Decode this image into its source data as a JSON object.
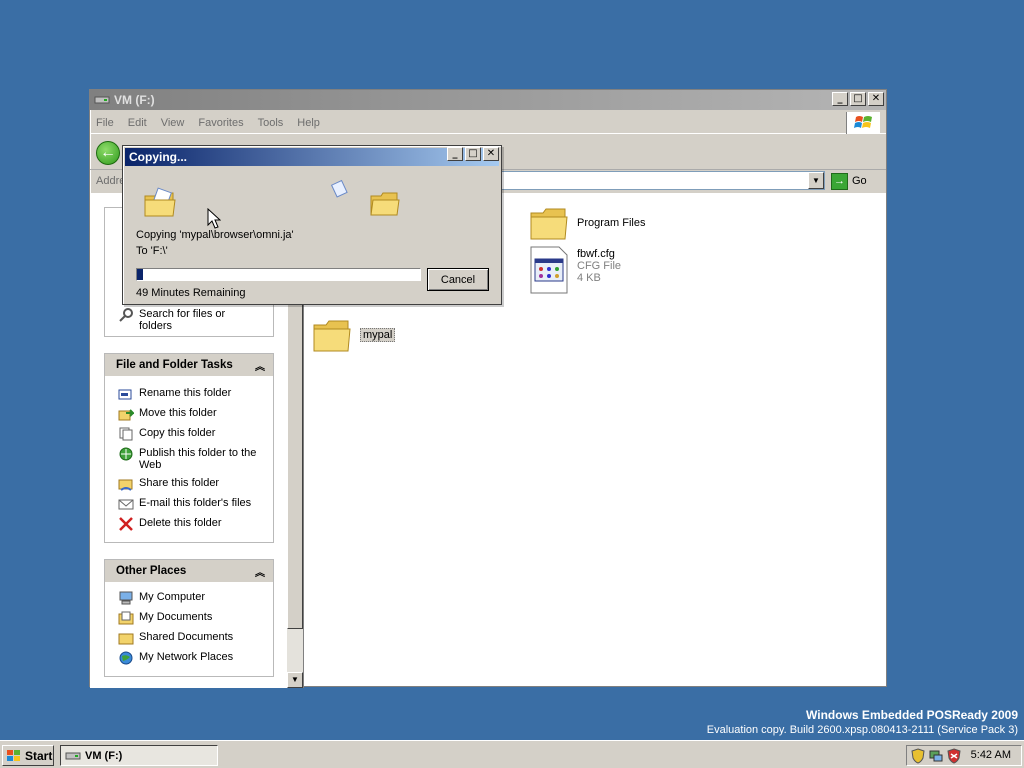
{
  "explorer": {
    "title": "VM (F:)",
    "menu": [
      "File",
      "Edit",
      "View",
      "Favorites",
      "Tools",
      "Help"
    ],
    "address_label": "Addre",
    "go_label": "Go"
  },
  "taskpane": {
    "file_tasks": {
      "title": "File and Folder Tasks",
      "items": [
        {
          "label": "Rename this folder",
          "icon": "rename-icon"
        },
        {
          "label": "Move this folder",
          "icon": "move-icon"
        },
        {
          "label": "Copy this folder",
          "icon": "copy-icon"
        },
        {
          "label": "Publish this folder to the Web",
          "icon": "publish-icon"
        },
        {
          "label": "Share this folder",
          "icon": "share-icon"
        },
        {
          "label": "E-mail this folder's files",
          "icon": "email-icon"
        },
        {
          "label": "Delete this folder",
          "icon": "delete-icon"
        }
      ]
    },
    "partial_search": {
      "label": "Search for files or folders"
    },
    "other_places": {
      "title": "Other Places",
      "items": [
        {
          "label": "My Computer",
          "icon": "my-computer-icon"
        },
        {
          "label": "My Documents",
          "icon": "my-documents-icon"
        },
        {
          "label": "Shared Documents",
          "icon": "shared-documents-icon"
        },
        {
          "label": "My Network Places",
          "icon": "network-places-icon"
        }
      ]
    }
  },
  "content": {
    "items": [
      {
        "name": "Program Files",
        "type": "folder"
      },
      {
        "name": "fbwf.cfg",
        "subtitle": "CFG File",
        "size": "4 KB",
        "type": "file"
      },
      {
        "name": "mypal",
        "type": "folder"
      }
    ]
  },
  "dialog": {
    "title": "Copying...",
    "copying_line": "Copying 'mypal\\browser\\omni.ja'",
    "to_line": "To 'F:\\'",
    "remaining": "49 Minutes Remaining",
    "cancel_label": "Cancel",
    "progress_fraction": 0.02
  },
  "watermark": {
    "line1": "Windows Embedded POSReady 2009",
    "line2": "Evaluation copy. Build 2600.xpsp.080413-2111 (Service Pack 3)"
  },
  "taskbar": {
    "start_label": "Start",
    "task_label": "VM (F:)",
    "clock": "5:42 AM"
  },
  "colors": {
    "desktop": "#3a6ea5",
    "active_title": "#0a246a",
    "progress": "#0a246a"
  }
}
